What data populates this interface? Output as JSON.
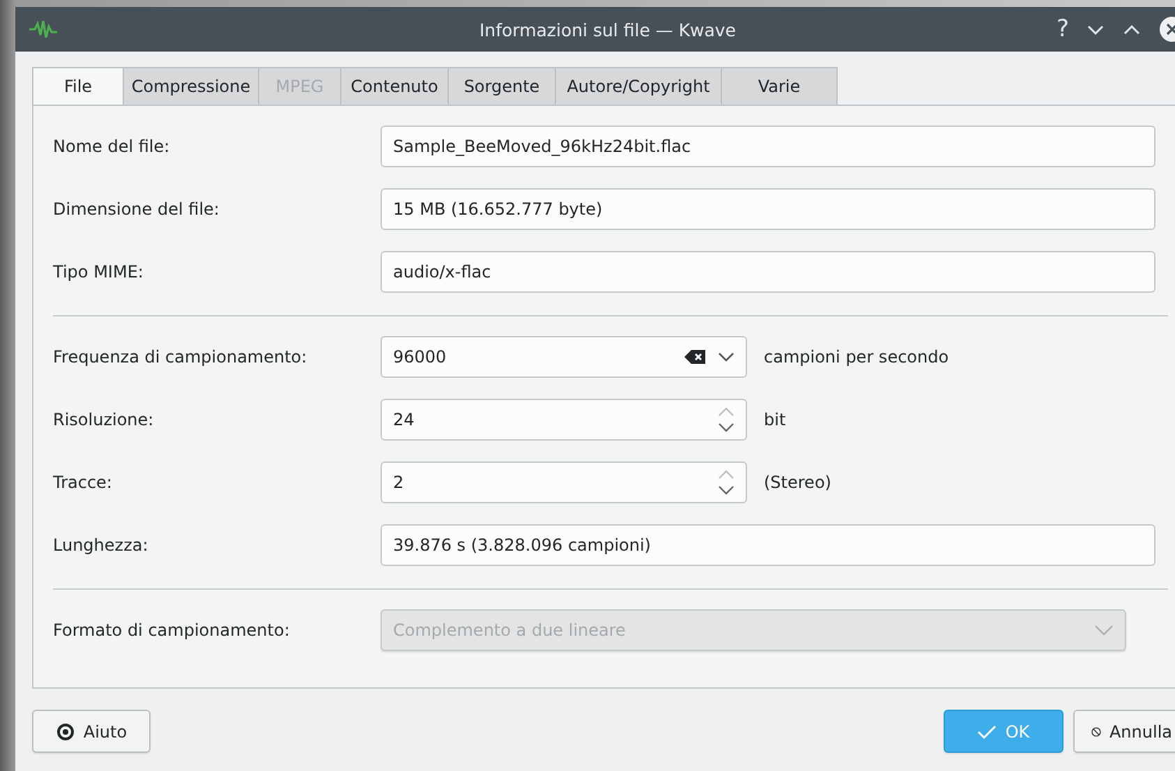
{
  "window": {
    "title": "Informazioni sul file — Kwave",
    "controls": [
      "?"
    ]
  },
  "tabs": [
    {
      "label": "File",
      "selected": true,
      "disabled": false
    },
    {
      "label": "Compressione",
      "selected": false,
      "disabled": false
    },
    {
      "label": "MPEG",
      "selected": false,
      "disabled": true
    },
    {
      "label": "Contenuto",
      "selected": false,
      "disabled": false
    },
    {
      "label": "Sorgente",
      "selected": false,
      "disabled": false
    },
    {
      "label": "Autore/Copyright",
      "selected": false,
      "disabled": false
    },
    {
      "label": "Varie",
      "selected": false,
      "disabled": false
    }
  ],
  "sections": [
    {
      "fields": [
        {
          "kind": "text",
          "label": "Nome del file:",
          "value": "Sample_BeeMoved_96kHz24bit.flac"
        },
        {
          "kind": "text",
          "label": "Dimensione del file:",
          "value": "15 MB (16.652.777 byte)"
        },
        {
          "kind": "text",
          "label": "Tipo MIME:",
          "value": "audio/x-flac"
        }
      ]
    },
    {
      "fields": [
        {
          "kind": "combo-edit",
          "label": "Frequenza di campionamento:",
          "value": "96000",
          "suffix": "campioni per secondo"
        },
        {
          "kind": "spin",
          "label": "Risoluzione:",
          "value": "24",
          "suffix": "bit",
          "up_enabled": false
        },
        {
          "kind": "spin",
          "label": "Tracce:",
          "value": "2",
          "suffix": "(Stereo)",
          "up_enabled": false
        },
        {
          "kind": "text",
          "label": "Lunghezza:",
          "value": "39.876 s (3.828.096 campioni)"
        }
      ]
    },
    {
      "fields": [
        {
          "kind": "combo",
          "label": "Formato di campionamento:",
          "value": "Complemento a due lineare",
          "disabled": true
        }
      ]
    }
  ],
  "buttons": [
    {
      "kind": "help",
      "label": "Aiuto",
      "default": false
    },
    {
      "kind": "ok",
      "label": "OK",
      "default": true
    },
    {
      "kind": "cancel",
      "label": "Annulla",
      "default": false
    }
  ]
}
